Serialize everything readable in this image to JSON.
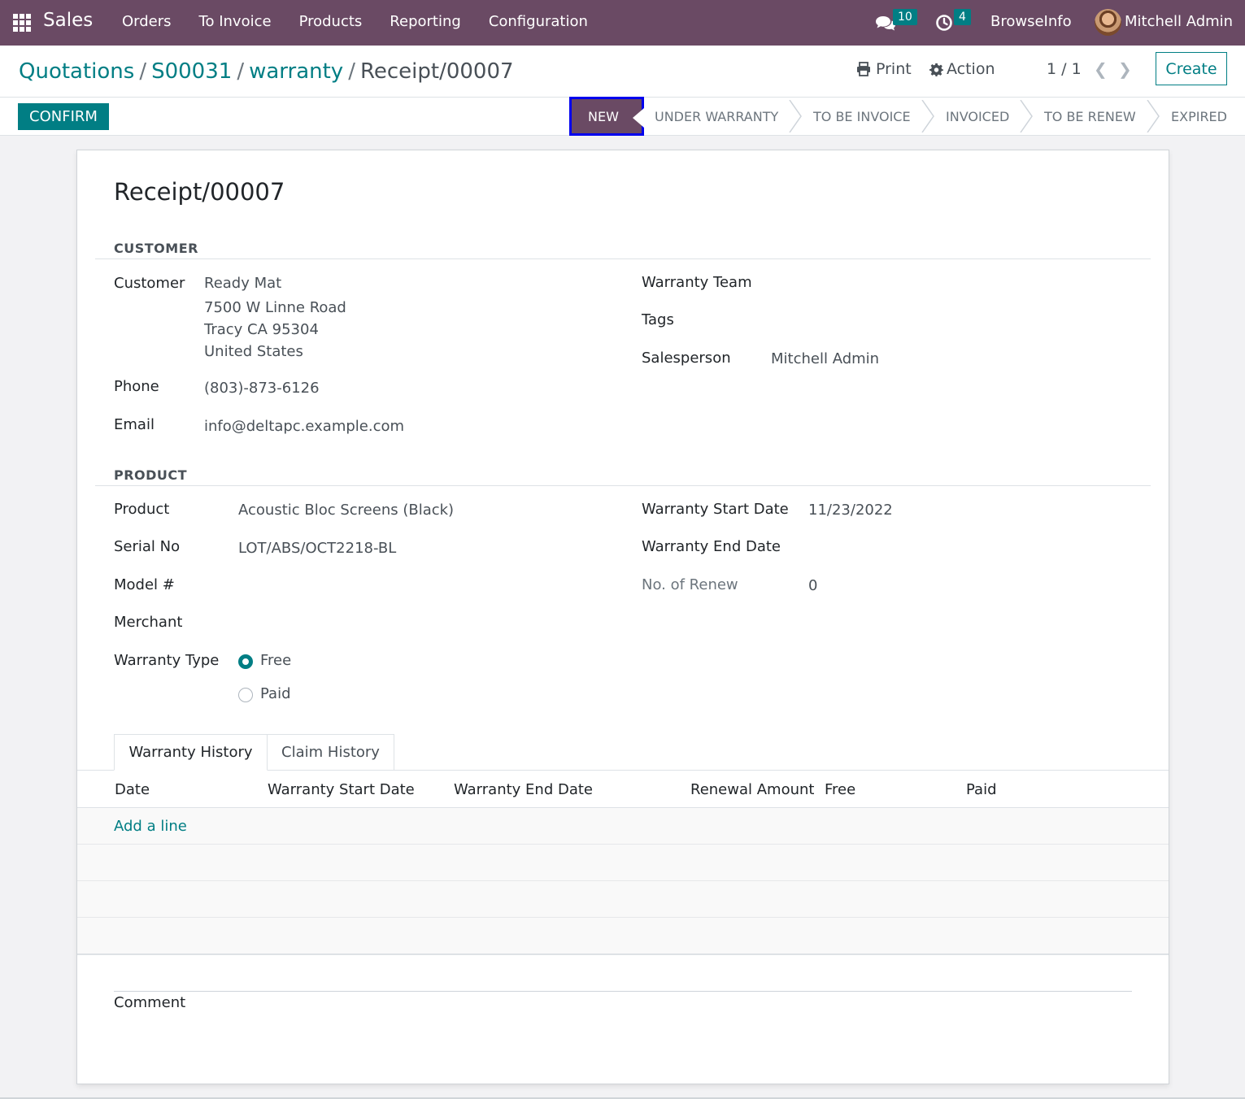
{
  "navbar": {
    "app_name": "Sales",
    "menu": [
      "Orders",
      "To Invoice",
      "Products",
      "Reporting",
      "Configuration"
    ],
    "messages_count": "10",
    "activities_count": "4",
    "company": "BrowseInfo",
    "user": "Mitchell Admin",
    "bg_color": "#6a4a64"
  },
  "breadcrumb": {
    "items": [
      "Quotations",
      "S00031",
      "warranty"
    ],
    "current": "Receipt/00007"
  },
  "toolbar": {
    "print_label": "Print",
    "action_label": "Action",
    "pager": "1 / 1",
    "create_label": "Create",
    "confirm_label": "CONFIRM"
  },
  "status_stages": {
    "current": "NEW",
    "others": [
      "UNDER WARRANTY",
      "TO BE INVOICE",
      "INVOICED",
      "TO BE RENEW",
      "EXPIRED"
    ]
  },
  "form": {
    "title": "Receipt/00007",
    "customer_section": "CUSTOMER",
    "customer_label": "Customer",
    "customer_name": "Ready Mat",
    "customer_address_1": "7500 W Linne Road",
    "customer_address_2": "Tracy CA 95304",
    "customer_address_3": "United States",
    "phone_label": "Phone",
    "phone": "(803)-873-6126",
    "email_label": "Email",
    "email": "info@deltapc.example.com",
    "warranty_team_label": "Warranty Team",
    "tags_label": "Tags",
    "salesperson_label": "Salesperson",
    "salesperson": "Mitchell Admin",
    "product_section": "PRODUCT",
    "product_label": "Product",
    "product": "Acoustic Bloc Screens (Black)",
    "serial_label": "Serial No",
    "serial": "LOT/ABS/OCT2218-BL",
    "model_label": "Model #",
    "merchant_label": "Merchant",
    "warranty_type_label": "Warranty Type",
    "warranty_type_options": [
      "Free",
      "Paid"
    ],
    "warranty_type_selected": "Free",
    "start_date_label": "Warranty Start Date",
    "start_date": "11/23/2022",
    "end_date_label": "Warranty End Date",
    "renew_label": "No. of Renew",
    "renew": "0"
  },
  "tabs": [
    "Warranty History",
    "Claim History"
  ],
  "history_table": {
    "columns": [
      "Date",
      "Warranty Start Date",
      "Warranty End Date",
      "Renewal Amount",
      "Free",
      "Paid"
    ],
    "add_line_label": "Add a line"
  },
  "comment_label": "Comment"
}
